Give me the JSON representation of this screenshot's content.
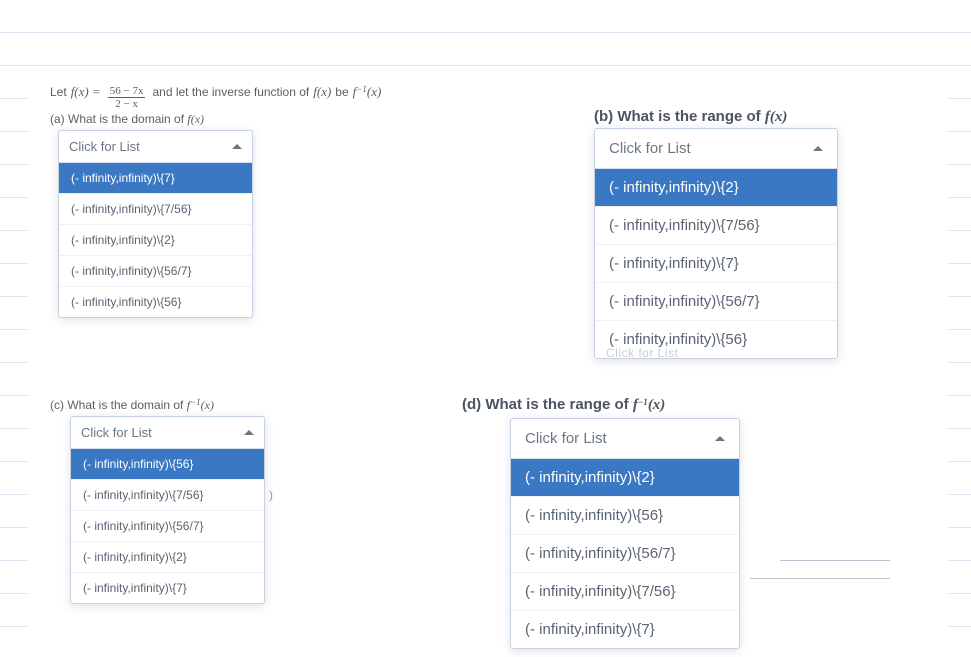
{
  "intro": {
    "let": "Let",
    "fx": "f(x) =",
    "frac_num": "56 − 7x",
    "frac_den": "2 − x",
    "mid": "and let  the inverse function of",
    "fx2": "f(x)",
    "be": "be",
    "finv": "f",
    "finv_exp": "−1",
    "finv_tail": "(x)"
  },
  "qa_label": "(a) What is the domain of ",
  "qa_fx": "f(x)",
  "qb_label": "(b) What is the range of ",
  "qb_fx": "f(x)",
  "qc_label": "(c) What is the domain of ",
  "qc_fx": "f",
  "qc_exp": "−1",
  "qc_tail": "(x)",
  "qd_label": "(d) What is the range of ",
  "qd_fx": "f",
  "qd_exp": "−1",
  "qd_tail": "(x)",
  "placeholder": "Click for List",
  "a_options": [
    "(- infinity,infinity)\\{7}",
    "(- infinity,infinity)\\{7/56}",
    "(- infinity,infinity)\\{2}",
    "(- infinity,infinity)\\{56/7}",
    "(- infinity,infinity)\\{56}"
  ],
  "b_options": [
    "(- infinity,infinity)\\{2}",
    "(- infinity,infinity)\\{7/56}",
    "(- infinity,infinity)\\{7}",
    "(- infinity,infinity)\\{56/7}",
    "(- infinity,infinity)\\{56}"
  ],
  "c_options": [
    "(- infinity,infinity)\\{56}",
    "(- infinity,infinity)\\{7/56}",
    "(- infinity,infinity)\\{56/7}",
    "(- infinity,infinity)\\{2}",
    "(- infinity,infinity)\\{7}"
  ],
  "d_options": [
    "(- infinity,infinity)\\{2}",
    "(- infinity,infinity)\\{56}",
    "(- infinity,infinity)\\{56/7}",
    "(- infinity,infinity)\\{7/56}",
    "(- infinity,infinity)\\{7}"
  ],
  "ghost_text": "Click for List",
  "stray_paren": ")"
}
